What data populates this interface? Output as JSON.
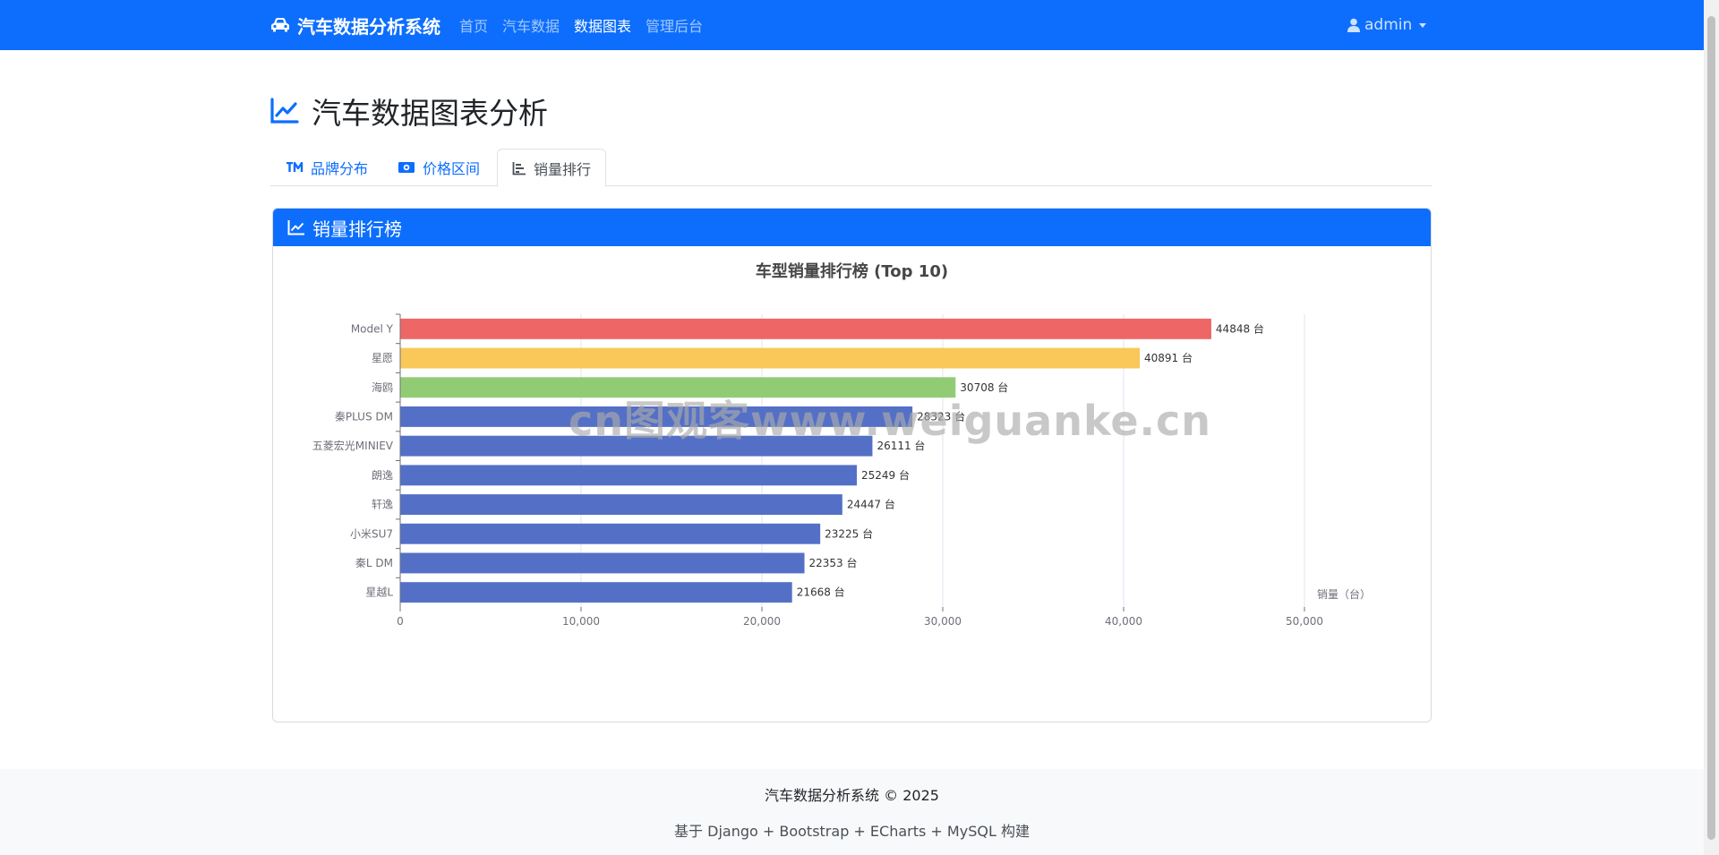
{
  "navbar": {
    "brand": "汽车数据分析系统",
    "links": [
      "首页",
      "汽车数据",
      "数据图表",
      "管理后台"
    ],
    "user": "admin"
  },
  "page": {
    "title": "汽车数据图表分析"
  },
  "tabs": [
    "品牌分布",
    "价格区间",
    "销量排行"
  ],
  "card": {
    "title": "销量排行榜"
  },
  "chart_data": {
    "type": "bar",
    "orientation": "horizontal",
    "title": "车型销量排行榜 (Top 10)",
    "categories": [
      "Model Y",
      "星愿",
      "海鸥",
      "秦PLUS DM",
      "五菱宏光MINIEV",
      "朗逸",
      "轩逸",
      "小米SU7",
      "秦L DM",
      "星越L"
    ],
    "values": [
      44848,
      40891,
      30708,
      28323,
      26111,
      25249,
      24447,
      23225,
      22353,
      21668
    ],
    "value_suffix": " 台",
    "colors": [
      "#ee6666",
      "#fac858",
      "#91cc75",
      "#5470c6",
      "#5470c6",
      "#5470c6",
      "#5470c6",
      "#5470c6",
      "#5470c6",
      "#5470c6"
    ],
    "xlabel": "销量（台）",
    "xlim": [
      0,
      50000
    ],
    "xticks": [
      "0",
      "10,000",
      "20,000",
      "30,000",
      "40,000",
      "50,000"
    ],
    "grid": true
  },
  "watermark": "cn图观客www.weiguanke.cn",
  "footer": {
    "line1": "汽车数据分析系统 © 2025",
    "line2": "基于 Django + Bootstrap + ECharts + MySQL 构建"
  }
}
